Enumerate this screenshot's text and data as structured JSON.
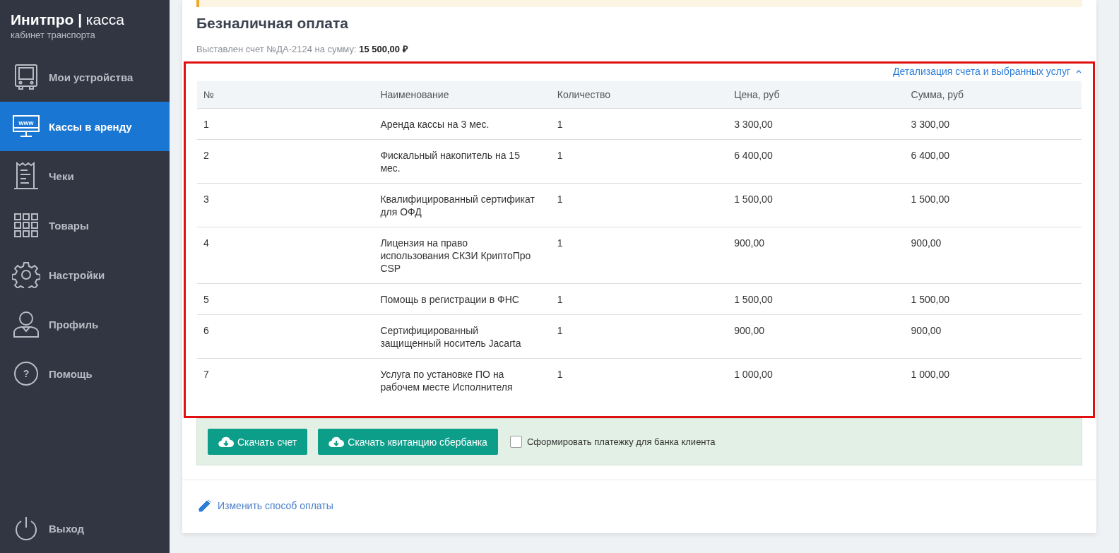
{
  "brand": {
    "name": "**Инитпро |** касса",
    "subtitle": "кабинет транспорта"
  },
  "nav": [
    {
      "label": "Мои устройства",
      "selected": false
    },
    {
      "label": "Кассы в аренду",
      "selected": true,
      "icon_text": "www"
    },
    {
      "label": "Чеки",
      "selected": false
    },
    {
      "label": "Товары",
      "selected": false
    },
    {
      "label": "Настройки",
      "selected": false
    },
    {
      "label": "Профиль",
      "selected": false
    },
    {
      "label": "Помощь",
      "selected": false,
      "icon_text": "?"
    }
  ],
  "logout": {
    "label": "Выход"
  },
  "payment": {
    "title": "Безналичная оплата",
    "invoice_text": "Выставлен счет №ДА-2124 на сумму: **15 500,00 ₽**",
    "details_link": {
      "label": "Детализация счета и выбранных услуг",
      "expanded": true
    },
    "table": {
      "columns": [
        "№",
        "Наименование",
        "Количество",
        "Цена, руб",
        "Сумма, руб"
      ],
      "rows": [
        [
          "1",
          "Аренда кассы на 3 мес.",
          "1",
          "3 300,00",
          "3 300,00"
        ],
        [
          "2",
          "Фискальный накопитель на 15 мес.",
          "1",
          "6 400,00",
          "6 400,00"
        ],
        [
          "3",
          "Квалифицированный сертификат для ОФД",
          "1",
          "1 500,00",
          "1 500,00"
        ],
        [
          "4",
          "Лицензия на право использования СКЗИ КриптоПро CSP",
          "1",
          "900,00",
          "900,00"
        ],
        [
          "5",
          "Помощь в регистрации в ФНС",
          "1",
          "1 500,00",
          "1 500,00"
        ],
        [
          "6",
          "Сертифицированный защищенный носитель Jacarta",
          "1",
          "900,00",
          "900,00"
        ],
        [
          "7",
          "Услуга по установке ПО на рабочем месте Исполнителя",
          "1",
          "1 000,00",
          "1 000,00"
        ]
      ]
    },
    "buttons": [
      "Скачать счет",
      "Скачать квитанцию сбербанка"
    ],
    "checkbox": {
      "label": "Сформировать платежку для банка клиента",
      "checked": false
    },
    "change_link": "Изменить способ оплаты"
  }
}
